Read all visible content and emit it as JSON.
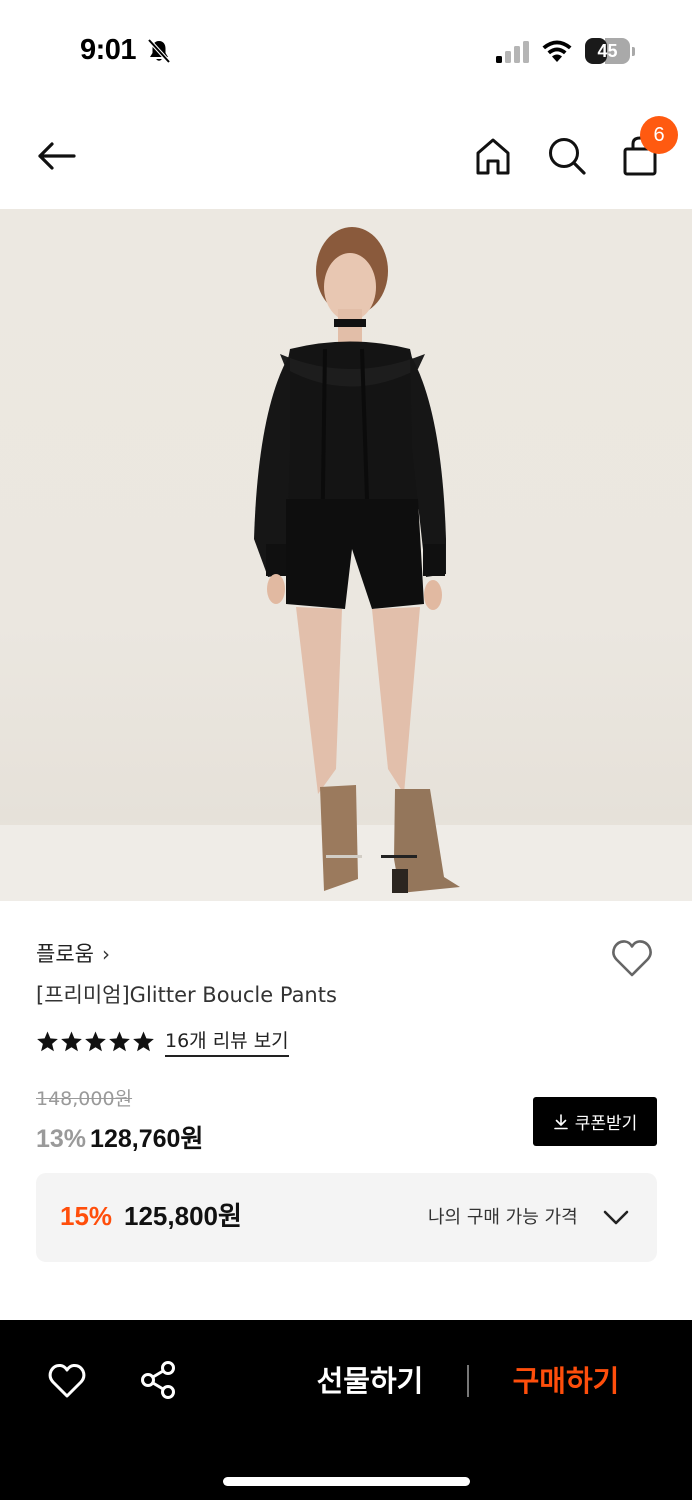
{
  "status_bar": {
    "time": "9:01",
    "battery": "45",
    "battery_level": 0.45,
    "icons": [
      "bell-muted-icon",
      "signal-icon",
      "wifi-icon",
      "battery-icon"
    ]
  },
  "top_nav": {
    "icons": [
      "back-icon",
      "home-icon",
      "search-icon",
      "cart-icon"
    ],
    "cart_count": "6",
    "badge_color": "#ff5a10"
  },
  "carousel": {
    "total": 2,
    "active": 2
  },
  "product": {
    "brand": "플로움",
    "brand_chevron": "›",
    "title": "[프리미엄]Glitter Boucle Pants",
    "rating": 5,
    "review_link": "16개 리뷰 보기",
    "original_price": "148,000원",
    "discount": "13%",
    "sale_price": "128,760원",
    "coupon_label": "쿠폰받기"
  },
  "my_price": {
    "discount": "15%",
    "price": "125,800원",
    "label": "나의 구매 가능 가격",
    "accent_color": "#ff4e0b"
  },
  "bottom_bar": {
    "gift_label": "선물하기",
    "buy_label": "구매하기",
    "icons": [
      "heart-icon",
      "share-icon"
    ]
  }
}
